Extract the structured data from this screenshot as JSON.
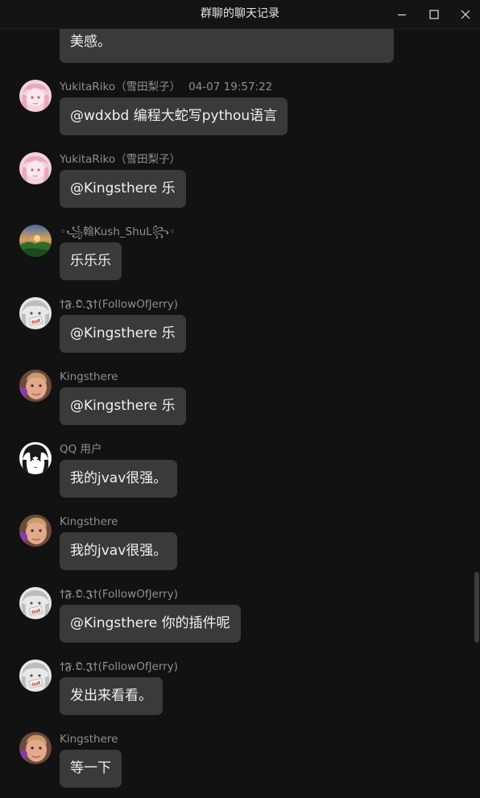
{
  "window": {
    "title": "群聊的聊天记录",
    "controls": [
      "minimize-icon",
      "maximize-icon",
      "close-icon"
    ]
  },
  "messages": [
    {
      "partial_text": "美感。"
    },
    {
      "sender": "YukitaRiko（雪田梨子）",
      "time": "04-07 19:57:22",
      "text": "@wdxbd 编程大蛇写pythou语言",
      "avatar": "anime-girl-pink"
    },
    {
      "sender": "YukitaRiko（雪田梨子）",
      "text": "@Kingsthere 乐",
      "avatar": "anime-girl-pink"
    },
    {
      "sender": "◦꧁翰Kush_ShuL꧂◦",
      "text": "乐乐乐",
      "avatar": "landscape-sunset"
    },
    {
      "sender": "†𝕱.𝕺.𝕵†(FollowOfJerry)",
      "text": "@Kingsthere 乐",
      "avatar": "anime-out-sign"
    },
    {
      "sender": "Kingsthere",
      "text": "@Kingsthere 乐",
      "avatar": "man-face"
    },
    {
      "sender": "QQ 用户",
      "text": "我的jvav很强。",
      "avatar": "manga-girl"
    },
    {
      "sender": "Kingsthere",
      "text": "我的jvav很强。",
      "avatar": "man-face"
    },
    {
      "sender": "†𝕱.𝕺.𝕵†(FollowOfJerry)",
      "text": "@Kingsthere 你的插件呢",
      "avatar": "anime-out-sign"
    },
    {
      "sender": "†𝕱.𝕺.𝕵†(FollowOfJerry)",
      "text": "发出来看看。",
      "avatar": "anime-out-sign"
    },
    {
      "sender": "Kingsthere",
      "text": "等一下",
      "avatar": "man-face"
    }
  ],
  "colors": {
    "background": "#121212",
    "bubble": "#3a3a3a",
    "sender_text": "#8f8f8f",
    "message_text": "#f0f0f0"
  }
}
